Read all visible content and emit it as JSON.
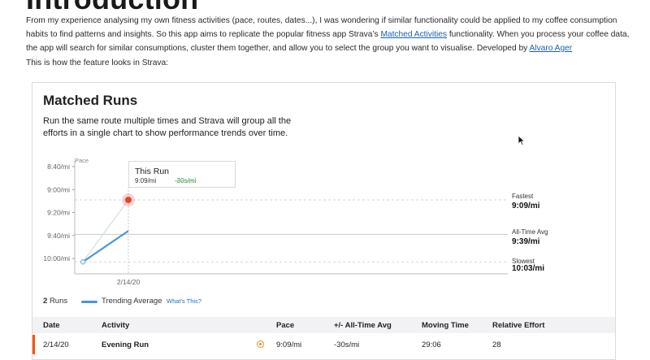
{
  "page": {
    "title": "Introduction",
    "intro_before_link": "From my experience analysing my own fitness activities (pace, routes, dates...), I was wondering if similar functionality could be applied to my coffee consumption habits to find patterns and insights. So this app aims to replicate the popular fitness app Strava’s ",
    "intro_link": "Matched Activities",
    "intro_after_link": " functionality. When you process your coffee data, the app will search for similar consumptions, cluster them together, and allow you to select the group you want to visualise. Developed by ",
    "author_link": "Alvaro Ager",
    "note": "This is how the feature looks in Strava:"
  },
  "strava": {
    "title": "Matched Runs",
    "description": "Run the same route multiple times and Strava will group all the efforts in a single chart to show performance trends over time.",
    "tooltip": {
      "title": "This Run",
      "pace": "9:09/mi",
      "diff": "-30s/mi"
    },
    "reference_lines": [
      {
        "label": "Fastest",
        "value": "9:09/mi"
      },
      {
        "label": "All-Time Avg",
        "value": "9:39/mi"
      },
      {
        "label": "Slowest",
        "value": "10:03/mi"
      }
    ],
    "legend": {
      "count": "2",
      "count_unit": "Runs",
      "trend_label": "Trending Average",
      "help_link": "What's This?"
    },
    "table": {
      "headers": [
        "Date",
        "Activity",
        "Pace",
        "+/- All-Time Avg",
        "Moving Time",
        "Relative Effort"
      ],
      "rows": [
        {
          "date": "2/14/20",
          "activity": "Evening Run",
          "pace": "9:09/mi",
          "diff": "-30s/mi",
          "moving_time": "29:06",
          "relative_effort": "28"
        }
      ]
    },
    "colors": {
      "accent": "#fc5200",
      "trend": "#4a95d8",
      "highlight": "#e8412c"
    }
  },
  "chart_data": {
    "type": "line",
    "ylabel": "Pace",
    "y_ticks": [
      "8:40/mi",
      "9:00/mi",
      "9:20/mi",
      "9:40/mi",
      "10:00/mi"
    ],
    "y_values_sec": [
      520,
      540,
      560,
      580,
      600
    ],
    "ylim_sec": [
      515,
      605
    ],
    "x_ticks": [
      "2/14/20"
    ],
    "series": [
      {
        "values_sec": [
          603,
          549
        ]
      },
      {
        "name": "Trending Average",
        "values_sec": [
          603,
          576
        ]
      }
    ],
    "reference_sec": [
      549,
      579,
      603
    ]
  }
}
